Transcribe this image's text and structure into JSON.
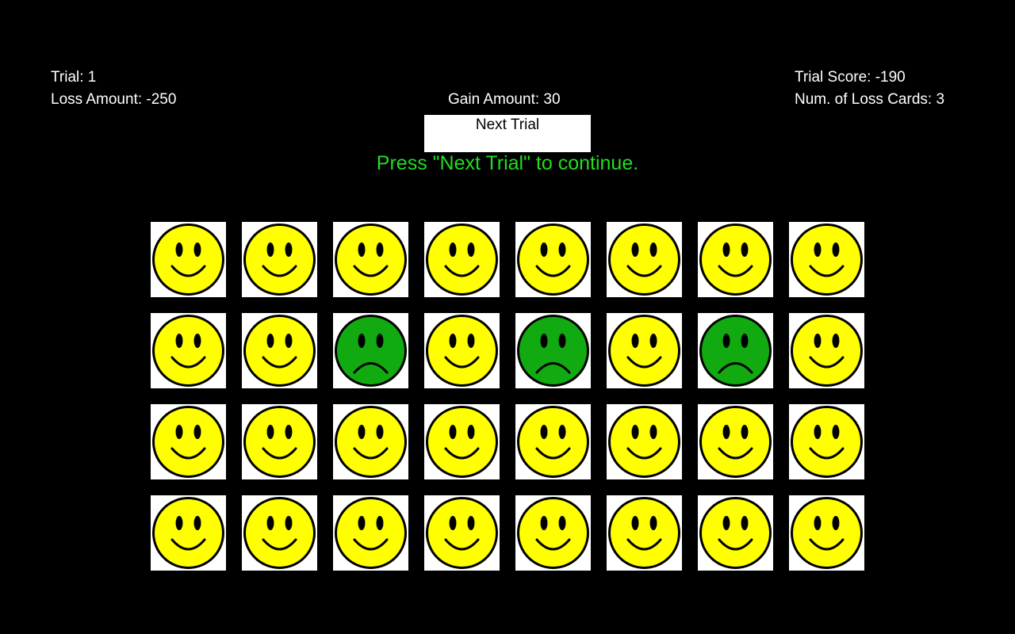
{
  "header": {
    "trial_text": "Trial: 1",
    "loss_amount_text": "Loss Amount: -250",
    "gain_amount_text": "Gain Amount: 30",
    "trial_score_text": "Trial Score: -190",
    "loss_cards_text": "Num. of Loss Cards: 3"
  },
  "controls": {
    "next_trial_label": "Next Trial"
  },
  "instruction": {
    "text": "Press \"Next Trial\" to continue."
  },
  "colors": {
    "background": "#000000",
    "card_background": "#ffffff",
    "gain_face": "#ffff00",
    "loss_face": "#11aa11",
    "instruction_text": "#22dd22"
  },
  "cards": {
    "rows": 4,
    "columns": 8,
    "grid": [
      [
        "gain-face-icon",
        "gain-face-icon",
        "gain-face-icon",
        "gain-face-icon",
        "gain-face-icon",
        "gain-face-icon",
        "gain-face-icon",
        "gain-face-icon"
      ],
      [
        "gain-face-icon",
        "gain-face-icon",
        "loss-face-icon",
        "gain-face-icon",
        "loss-face-icon",
        "gain-face-icon",
        "loss-face-icon",
        "gain-face-icon"
      ],
      [
        "gain-face-icon",
        "gain-face-icon",
        "gain-face-icon",
        "gain-face-icon",
        "gain-face-icon",
        "gain-face-icon",
        "gain-face-icon",
        "gain-face-icon"
      ],
      [
        "gain-face-icon",
        "gain-face-icon",
        "gain-face-icon",
        "gain-face-icon",
        "gain-face-icon",
        "gain-face-icon",
        "gain-face-icon",
        "gain-face-icon"
      ]
    ]
  }
}
